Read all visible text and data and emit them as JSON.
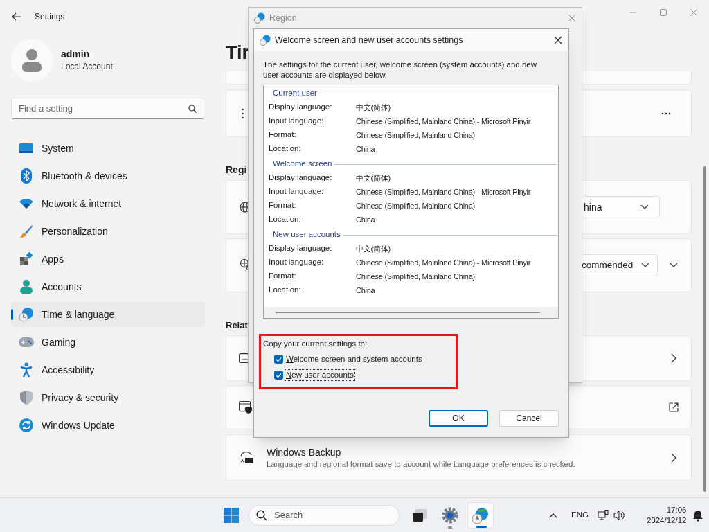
{
  "window": {
    "title": "Settings"
  },
  "profile": {
    "name": "admin",
    "account_type": "Local Account"
  },
  "search": {
    "placeholder": "Find a setting"
  },
  "sidebar": {
    "items": [
      {
        "label": "System",
        "selected": false
      },
      {
        "label": "Bluetooth & devices",
        "selected": false
      },
      {
        "label": "Network & internet",
        "selected": false
      },
      {
        "label": "Personalization",
        "selected": false
      },
      {
        "label": "Apps",
        "selected": false
      },
      {
        "label": "Accounts",
        "selected": false
      },
      {
        "label": "Time & language",
        "selected": true
      },
      {
        "label": "Gaming",
        "selected": false
      },
      {
        "label": "Accessibility",
        "selected": false
      },
      {
        "label": "Privacy & security",
        "selected": false
      },
      {
        "label": "Windows Update",
        "selected": false
      }
    ]
  },
  "main": {
    "title": "Tir",
    "region_heading": "Regi",
    "country_dropdown": "hina",
    "format_dropdown": "commended",
    "related_heading": "Relat",
    "backup": {
      "title": "Windows Backup",
      "description": "Language and regional format save to account while Language preferences is checked."
    }
  },
  "region_dialog": {
    "title": "Region"
  },
  "settings_dialog": {
    "title": "Welcome screen and new user accounts settings",
    "intro": "The settings for the current user, welcome screen (system accounts) and new user accounts are displayed below.",
    "groups": [
      {
        "heading": "Current user",
        "rows": [
          {
            "label": "Display language:",
            "value": "中文(简体)"
          },
          {
            "label": "Input language:",
            "value": "Chinese (Simplified, Mainland China) - Microsoft Pinyir"
          },
          {
            "label": "Format:",
            "value": "Chinese (Simplified, Mainland China)"
          },
          {
            "label": "Location:",
            "value": "China"
          }
        ]
      },
      {
        "heading": "Welcome screen",
        "rows": [
          {
            "label": "Display language:",
            "value": "中文(简体)"
          },
          {
            "label": "Input language:",
            "value": "Chinese (Simplified, Mainland China) - Microsoft Pinyir"
          },
          {
            "label": "Format:",
            "value": "Chinese (Simplified, Mainland China)"
          },
          {
            "label": "Location:",
            "value": "China"
          }
        ]
      },
      {
        "heading": "New user accounts",
        "rows": [
          {
            "label": "Display language:",
            "value": "中文(简体)"
          },
          {
            "label": "Input language:",
            "value": "Chinese (Simplified, Mainland China) - Microsoft Pinyir"
          },
          {
            "label": "Format:",
            "value": "Chinese (Simplified, Mainland China)"
          },
          {
            "label": "Location:",
            "value": "China"
          }
        ]
      }
    ],
    "copy_label": "Copy your current settings to:",
    "options": [
      {
        "label": "Welcome screen and system accounts",
        "checked": true,
        "focused": false
      },
      {
        "label": "New user accounts",
        "checked": true,
        "focused": true
      }
    ],
    "buttons": [
      {
        "label": "OK",
        "default": true
      },
      {
        "label": "Cancel",
        "default": false
      }
    ]
  },
  "taskbar": {
    "search_placeholder": "Search",
    "apps": [
      {
        "kind": "taskview",
        "running": false,
        "active": false
      },
      {
        "kind": "settings",
        "running": true,
        "active": false
      },
      {
        "kind": "region",
        "running": true,
        "active": true
      }
    ],
    "language": "ENG",
    "time": "17:06",
    "date": "2024/12/12"
  }
}
